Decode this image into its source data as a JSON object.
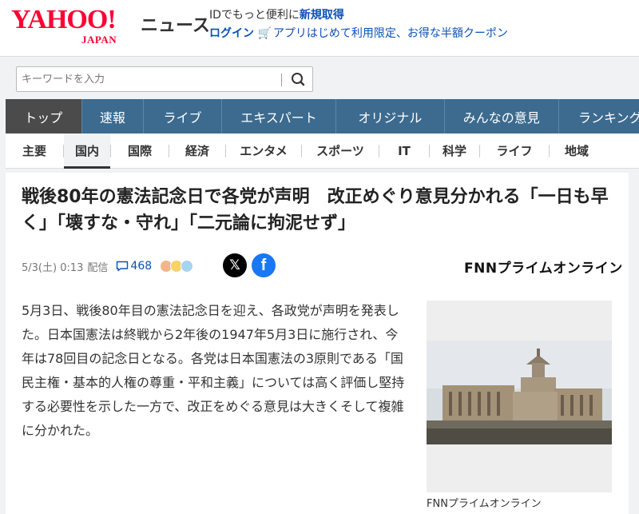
{
  "header": {
    "logo_main": "YAHOO!",
    "logo_sub": "JAPAN",
    "service": "ニュース",
    "promo_prefix": "IDでもっと便利に",
    "promo_signup": "新規取得",
    "login": "ログイン",
    "app_promo": "アプリはじめて利用限定、お得な半額クーポン",
    "brand_color": "#ff0033"
  },
  "search": {
    "placeholder": "キーワードを入力",
    "button_icon": "search-icon"
  },
  "nav_primary": {
    "items": [
      "トップ",
      "速報",
      "ライブ",
      "エキスパート",
      "オリジナル",
      "みんなの意見",
      "ランキング"
    ],
    "active": "トップ"
  },
  "nav_secondary": {
    "items": [
      "主要",
      "国内",
      "国際",
      "経済",
      "エンタメ",
      "スポーツ",
      "IT",
      "科学",
      "ライフ",
      "地域"
    ],
    "active": "国内"
  },
  "article": {
    "title": "戦後80年の憲法記念日で各党が声明　改正めぐり意見分かれる「一日も早く」「壊すな・守れ」「二元論に拘泥せず」",
    "date": "5/3(土) 0:13",
    "delivered": "配信",
    "comment_count": "468",
    "source": "FNNプライムオンライン",
    "body": "5月3日、戦後80年目の憲法記念日を迎え、各政党が声明を発表した。日本国憲法は終戦から2年後の1947年5月3日に施行され、今年は78回目の記念日となる。各党は日本国憲法の3原則である「国民主権・基本的人権の尊重・平和主義」については高く評価し堅持する必要性を示した一方で、改正をめぐる意見は大きくそして複雑に分かれた。",
    "photo_credit": "FNNプライムオンライン",
    "source_logo_text": "FNNプライムオンライン"
  }
}
